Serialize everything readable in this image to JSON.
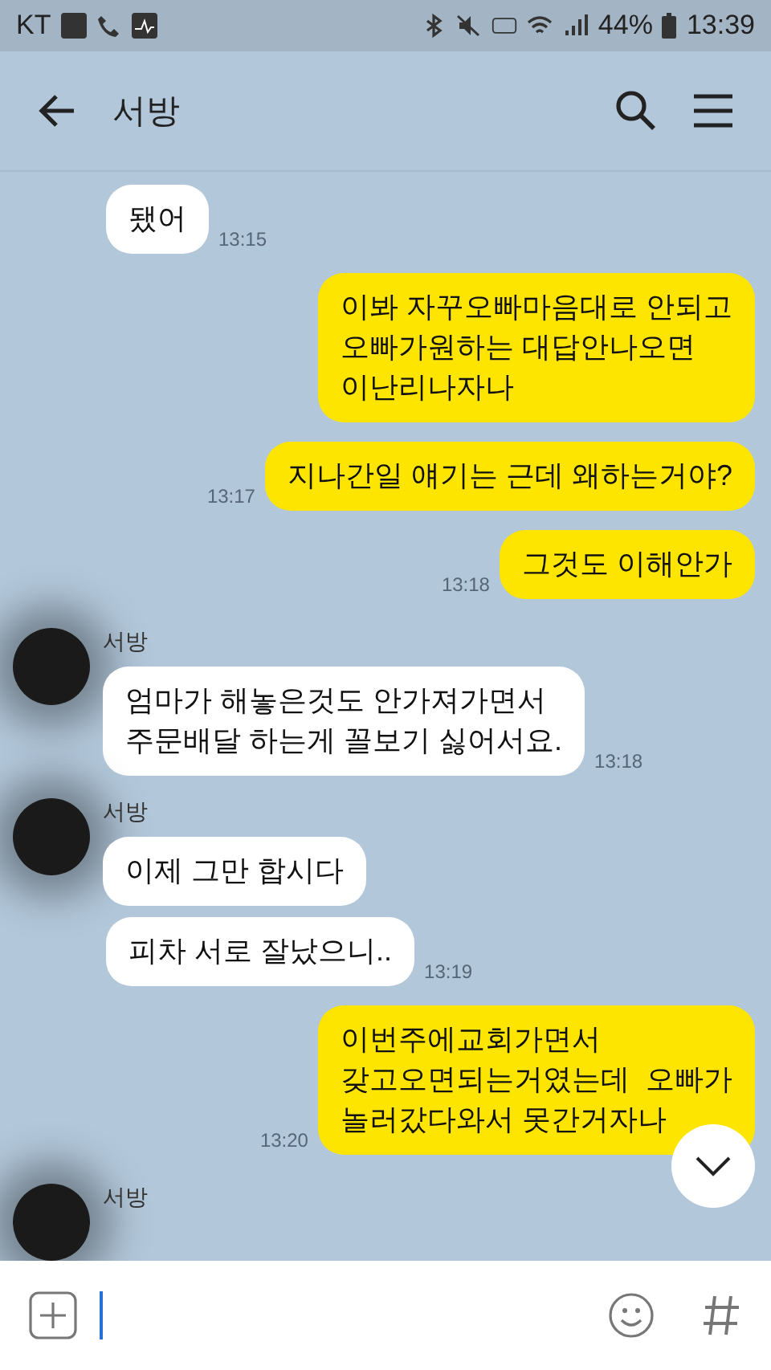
{
  "status_bar": {
    "carrier": "KT",
    "battery": "44%",
    "time": "13:39"
  },
  "header": {
    "title": "서방"
  },
  "messages": [
    {
      "kind": "received",
      "text": "됐어",
      "time": "13:15"
    },
    {
      "kind": "sent",
      "text": "이봐 자꾸오빠마음대로 안되고\n오빠가원하는 대답안나오면\n이난리나자나"
    },
    {
      "kind": "sent",
      "text": "지나간일 얘기는 근데 왜하는거야?",
      "time": "13:17"
    },
    {
      "kind": "sent",
      "text": "그것도 이해안가",
      "time": "13:18"
    },
    {
      "kind": "received",
      "sender": "서방",
      "text": "엄마가 해놓은것도 안가져가면서\n주문배달 하는게 꼴보기 싫어서요.",
      "time": "13:18"
    },
    {
      "kind": "received",
      "sender": "서방",
      "text": "이제 그만 합시다"
    },
    {
      "kind": "received",
      "text": "피차 서로 잘났으니..",
      "time": "13:19"
    },
    {
      "kind": "sent",
      "text": "이번주에교회가면서\n갖고오면되는거였는데  오빠가\n놀러갔다와서 못간거자나",
      "time": "13:20"
    },
    {
      "kind": "received",
      "sender": "서방"
    }
  ]
}
